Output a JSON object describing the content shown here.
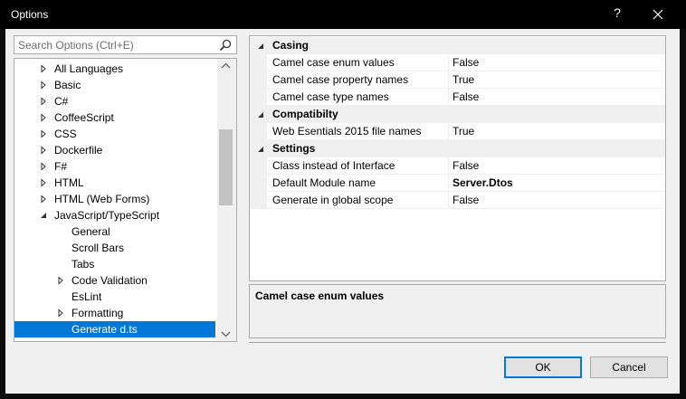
{
  "window": {
    "title": "Options",
    "help_label": "?"
  },
  "search": {
    "placeholder": "Search Options (Ctrl+E)"
  },
  "tree": {
    "items": [
      {
        "label": "All Languages",
        "level": 0,
        "expander": "collapsed"
      },
      {
        "label": "Basic",
        "level": 0,
        "expander": "collapsed"
      },
      {
        "label": "C#",
        "level": 0,
        "expander": "collapsed"
      },
      {
        "label": "CoffeeScript",
        "level": 0,
        "expander": "collapsed"
      },
      {
        "label": "CSS",
        "level": 0,
        "expander": "collapsed"
      },
      {
        "label": "Dockerfile",
        "level": 0,
        "expander": "collapsed"
      },
      {
        "label": "F#",
        "level": 0,
        "expander": "collapsed"
      },
      {
        "label": "HTML",
        "level": 0,
        "expander": "collapsed"
      },
      {
        "label": "HTML (Web Forms)",
        "level": 0,
        "expander": "collapsed"
      },
      {
        "label": "JavaScript/TypeScript",
        "level": 0,
        "expander": "expanded"
      },
      {
        "label": "General",
        "level": 1,
        "expander": "none"
      },
      {
        "label": "Scroll Bars",
        "level": 1,
        "expander": "none"
      },
      {
        "label": "Tabs",
        "level": 1,
        "expander": "none"
      },
      {
        "label": "Code Validation",
        "level": 1,
        "expander": "collapsed"
      },
      {
        "label": "EsLint",
        "level": 1,
        "expander": "none"
      },
      {
        "label": "Formatting",
        "level": 1,
        "expander": "collapsed"
      },
      {
        "label": "Generate d.ts",
        "level": 1,
        "expander": "none",
        "selected": true
      }
    ]
  },
  "properties": {
    "categories": [
      {
        "name": "Casing",
        "rows": [
          {
            "name": "Camel case enum values",
            "value": "False"
          },
          {
            "name": "Camel case property names",
            "value": "True"
          },
          {
            "name": "Camel case type names",
            "value": "False"
          }
        ]
      },
      {
        "name": "Compatibilty",
        "rows": [
          {
            "name": "Web Esentials 2015 file names",
            "value": "True"
          }
        ]
      },
      {
        "name": "Settings",
        "rows": [
          {
            "name": "Class instead of Interface",
            "value": "False"
          },
          {
            "name": "Default Module name",
            "value": "Server.Dtos",
            "bold": true
          },
          {
            "name": "Generate in global scope",
            "value": "False"
          }
        ]
      }
    ]
  },
  "description": {
    "title": "Camel case enum values"
  },
  "buttons": {
    "ok": "OK",
    "cancel": "Cancel"
  },
  "colors": {
    "selection": "#0078d7",
    "titlebar": "#000000",
    "dialog": "#f0f0f0"
  }
}
